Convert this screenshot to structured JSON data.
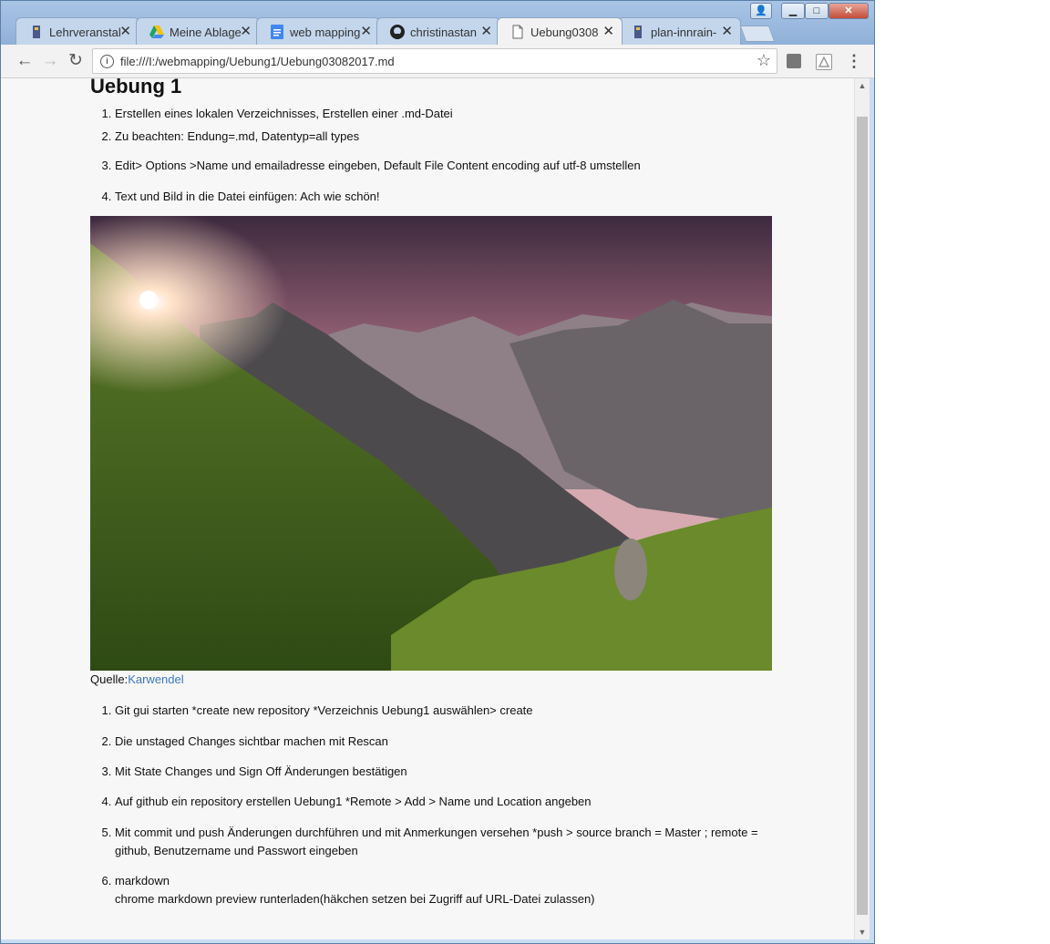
{
  "window": {
    "minimize_label": "▁",
    "maximize_label": "□",
    "close_label": "✕",
    "user_label": "👤"
  },
  "tabs": [
    {
      "label": "Lehrveranstal",
      "close": "✕",
      "icon": "university-icon",
      "active": false
    },
    {
      "label": "Meine Ablage",
      "close": "✕",
      "icon": "google-drive-icon",
      "active": false
    },
    {
      "label": "web mapping",
      "close": "✕",
      "icon": "google-docs-icon",
      "active": false
    },
    {
      "label": "christinastan",
      "close": "✕",
      "icon": "github-icon",
      "active": false
    },
    {
      "label": "Uebung0308",
      "close": "✕",
      "icon": "document-icon",
      "active": true
    },
    {
      "label": "plan-innrain-",
      "close": "✕",
      "icon": "university-icon",
      "active": false
    }
  ],
  "toolbar": {
    "back": "←",
    "forward": "→",
    "reload": "↻",
    "url": "file:///I:/webmapping/Uebung1/Uebung03082017.md",
    "info": "i",
    "star": "☆",
    "menu": "⋮"
  },
  "document": {
    "heading": "Uebung 1",
    "list1": [
      "Erstellen eines lokalen Verzeichnisses, Erstellen einer .md-Datei",
      "Zu beachten: Endung=.md, Datentyp=all types",
      "Edit> Options >Name und emailadresse eingeben, Default File Content encoding auf utf-8 umstellen",
      "Text und Bild in die Datei einfügen: Ach wie schön!"
    ],
    "caption_prefix": "Quelle:",
    "caption_link": "Karwendel",
    "list2": [
      "Git gui starten *create new repository *Verzeichnis Uebung1 auswählen> create",
      "Die unstaged Changes sichtbar machen mit Rescan",
      "Mit State Changes und Sign Off Änderungen bestätigen",
      "Auf github ein repository erstellen Uebung1 *Remote > Add > Name und Location angeben",
      "Mit commit und push Änderungen durchführen und mit Anmerkungen versehen *push > source branch = Master ; remote = github, Benutzername und Passwort eingeben"
    ],
    "list2_last_title": "markdown",
    "list2_last_text": "chrome markdown preview runterladen(häkchen setzen bei Zugriff auf URL-Datei zulassen)"
  }
}
